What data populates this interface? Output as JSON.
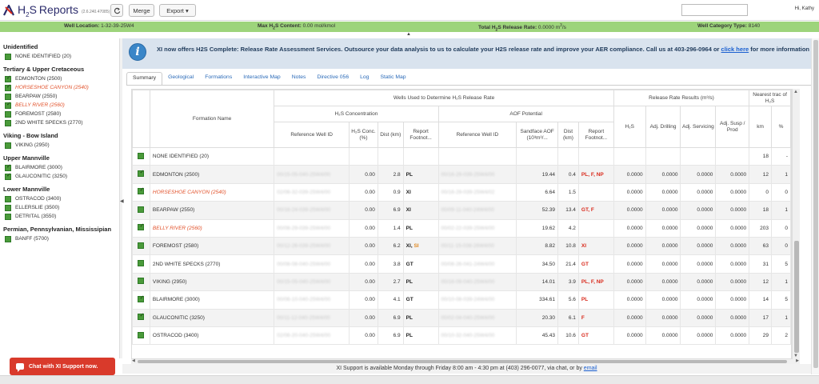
{
  "app": {
    "logo_text_h": "H",
    "logo_text_sub": "2",
    "logo_text_s": "S",
    "logo_text_reports": "Reports",
    "version": "(2.6.240.47085)",
    "refresh_icon": "refresh-icon",
    "merge_label": "Merge",
    "export_label": "Export",
    "export_caret": "▾",
    "user_greeting": "Hi, Kathy"
  },
  "infobar": {
    "well_location_label": "Well Location:",
    "well_location_value": "1-32-39-25W4",
    "max_h2s_label": "Max H",
    "max_h2s_sub": "2",
    "max_h2s_label_rest": "S Content:",
    "max_h2s_value": "0.00 mol/kmol",
    "total_release_label": "Total H",
    "total_release_sub": "2",
    "total_release_label_rest": "S Release Rate:",
    "total_release_value": "0.0000 m",
    "total_release_sup": "3",
    "total_release_unit_rest": "/s",
    "well_category_label": "Well Category Type:",
    "well_category_value": "8140"
  },
  "sidebar": {
    "groups": [
      {
        "title": "Unidentified",
        "items": [
          {
            "label": "NONE IDENTIFIED (20)",
            "style": "",
            "mark": false
          }
        ]
      },
      {
        "title": "Tertiary & Upper Cretaceous",
        "items": [
          {
            "label": "EDMONTON (2500)",
            "style": "",
            "mark": true
          },
          {
            "label": "HORSESHOE CANYON (2540)",
            "style": "red",
            "mark": true
          },
          {
            "label": "BEARPAW (2550)",
            "style": "",
            "mark": false
          },
          {
            "label": "BELLY RIVER (2560)",
            "style": "red",
            "mark": true
          },
          {
            "label": "FOREMOST (2580)",
            "style": "",
            "mark": false
          },
          {
            "label": "2ND WHITE SPECKS (2770)",
            "style": "",
            "mark": false
          }
        ]
      },
      {
        "title": "Viking - Bow Island",
        "items": [
          {
            "label": "VIKING (2950)",
            "style": "",
            "mark": false
          }
        ]
      },
      {
        "title": "Upper Mannville",
        "items": [
          {
            "label": "BLAIRMORE (3000)",
            "style": "",
            "mark": true
          },
          {
            "label": "GLAUCONITIC (3250)",
            "style": "",
            "mark": true
          }
        ]
      },
      {
        "title": "Lower Mannville",
        "items": [
          {
            "label": "OSTRACOD (3400)",
            "style": "",
            "mark": false
          },
          {
            "label": "ELLERSLIE (3500)",
            "style": "",
            "mark": false
          },
          {
            "label": "DETRITAL (3550)",
            "style": "",
            "mark": false
          }
        ]
      },
      {
        "title": "Permian, Pennsylvanian, Mississipian",
        "items": [
          {
            "label": "BANFF (5700)",
            "style": "",
            "mark": false
          }
        ]
      }
    ]
  },
  "chat": {
    "label": "Chat with XI Support now."
  },
  "banner": {
    "icon": "info-icon",
    "text": "XI now offers H2S Complete: Release Rate Assessment Services. Outsource your data analysis to us to calculate your H2S release rate and improve your AER compliance. Call us at 403-296-0964 or ",
    "link_text": "click here",
    "text_after": " for more information"
  },
  "tabs": [
    "Summary",
    "Geological",
    "Formations",
    "Interactive Map",
    "Notes",
    "Directive 056",
    "Log",
    "Static Map"
  ],
  "table": {
    "headers": {
      "formation_name": "Formation Name",
      "wells_used": "Wells Used to Determine H₂S Release Rate",
      "h2s_concentration": "H₂S Concentration",
      "aof_potential": "AOF Potential",
      "release_rate_results": "Release Rate Results (m³/s)",
      "nearest": "Nearest trac of H₂S",
      "reference_well_id": "Reference Well ID",
      "h2s_conc": "H₂S Conc. (%)",
      "dist_km": "Dist (km)",
      "report_footnote": "Report Footnot...",
      "sandface_aof": "Sandface AOF (10³m³/...",
      "h2s": "H₂S",
      "adj_drilling": "Adj. Drilling",
      "adj_servicing": "Adj. Servicing",
      "adj_susp_prod": "Adj. Susp / Prod",
      "km": "km",
      "pct": "%"
    },
    "rows": [
      {
        "name": "NONE IDENTIFIED (20)",
        "style": "",
        "mark": false,
        "ref1": "",
        "conc": "",
        "dist1": "",
        "fn1": [],
        "ref2": "",
        "aof": "",
        "dist2": "",
        "fn2": [],
        "h2s": "",
        "drill": "",
        "serv": "",
        "susp": "",
        "km": "18",
        "pct": "-"
      },
      {
        "name": "EDMONTON (2500)",
        "style": "",
        "mark": true,
        "ref1": "00/15-05-040-25W4/00",
        "conc": "0.00",
        "dist1": "2.8",
        "fn1": [
          {
            "t": "PL",
            "c": ""
          }
        ],
        "ref2": "00/16-29-039-25W4/00",
        "aof": "19.44",
        "dist2": "0.4",
        "fn2": [
          {
            "t": "PL, F, NP",
            "c": "r"
          }
        ],
        "h2s": "0.0000",
        "drill": "0.0000",
        "serv": "0.0000",
        "susp": "0.0000",
        "km": "12",
        "pct": "1"
      },
      {
        "name": "HORSESHOE CANYON (2540)",
        "style": "red",
        "mark": true,
        "ref1": "02/06-32-039-25W4/00",
        "conc": "0.00",
        "dist1": "0.9",
        "fn1": [
          {
            "t": "XI",
            "c": ""
          }
        ],
        "ref2": "00/16-29-039-25W4/02",
        "aof": "6.64",
        "dist2": "1.5",
        "fn2": [],
        "h2s": "0.0000",
        "drill": "0.0000",
        "serv": "0.0000",
        "susp": "0.0000",
        "km": "0",
        "pct": "0"
      },
      {
        "name": "BEARPAW (2550)",
        "style": "",
        "mark": false,
        "ref1": "00/16-24-039-25W4/00",
        "conc": "0.00",
        "dist1": "6.9",
        "fn1": [
          {
            "t": "XI",
            "c": ""
          }
        ],
        "ref2": "00/09-11-040-24W4/00",
        "aof": "52.39",
        "dist2": "13.4",
        "fn2": [
          {
            "t": "GT, F",
            "c": "r"
          }
        ],
        "h2s": "0.0000",
        "drill": "0.0000",
        "serv": "0.0000",
        "susp": "0.0000",
        "km": "18",
        "pct": "1"
      },
      {
        "name": "BELLY RIVER (2560)",
        "style": "red",
        "mark": true,
        "ref1": "00/08-29-039-25W4/00",
        "conc": "0.00",
        "dist1": "1.4",
        "fn1": [
          {
            "t": "PL",
            "c": ""
          }
        ],
        "ref2": "00/02-22-039-25W4/00",
        "aof": "19.62",
        "dist2": "4.2",
        "fn2": [],
        "h2s": "0.0000",
        "drill": "0.0000",
        "serv": "0.0000",
        "susp": "0.0000",
        "km": "203",
        "pct": "0"
      },
      {
        "name": "FOREMOST (2580)",
        "style": "",
        "mark": false,
        "ref1": "00/12-26-039-25W4/00",
        "conc": "0.00",
        "dist1": "6.2",
        "fn1": [
          {
            "t": "XI, ",
            "c": ""
          },
          {
            "t": "SI",
            "c": "o"
          }
        ],
        "ref2": "00/11-15-038-26W4/00",
        "aof": "8.82",
        "dist2": "10.8",
        "fn2": [
          {
            "t": "XI",
            "c": "r"
          }
        ],
        "h2s": "0.0000",
        "drill": "0.0000",
        "serv": "0.0000",
        "susp": "0.0000",
        "km": "63",
        "pct": "0"
      },
      {
        "name": "2ND WHITE SPECKS (2770)",
        "style": "",
        "mark": false,
        "ref1": "00/08-08-040-25W4/00",
        "conc": "0.00",
        "dist1": "3.8",
        "fn1": [
          {
            "t": "GT",
            "c": ""
          }
        ],
        "ref2": "00/08-26-041-24W4/00",
        "aof": "34.50",
        "dist2": "21.4",
        "fn2": [
          {
            "t": "GT",
            "c": "r"
          }
        ],
        "h2s": "0.0000",
        "drill": "0.0000",
        "serv": "0.0000",
        "susp": "0.0000",
        "km": "31",
        "pct": "5"
      },
      {
        "name": "VIKING (2950)",
        "style": "",
        "mark": false,
        "ref1": "00/15-05-040-25W4/00",
        "conc": "0.00",
        "dist1": "2.7",
        "fn1": [
          {
            "t": "PL",
            "c": ""
          }
        ],
        "ref2": "00/16-09-040-25W4/00",
        "aof": "14.01",
        "dist2": "3.9",
        "fn2": [
          {
            "t": "PL, F, NP",
            "c": "r"
          }
        ],
        "h2s": "0.0000",
        "drill": "0.0000",
        "serv": "0.0000",
        "susp": "0.0000",
        "km": "12",
        "pct": "1"
      },
      {
        "name": "BLAIRMORE (3000)",
        "style": "",
        "mark": true,
        "ref1": "00/06-10-040-25W4/00",
        "conc": "0.00",
        "dist1": "4.1",
        "fn1": [
          {
            "t": "GT",
            "c": ""
          }
        ],
        "ref2": "00/10-08-039-24W4/00",
        "aof": "334.61",
        "dist2": "5.6",
        "fn2": [
          {
            "t": "PL",
            "c": "r"
          }
        ],
        "h2s": "0.0000",
        "drill": "0.0000",
        "serv": "0.0000",
        "susp": "0.0000",
        "km": "14",
        "pct": "5"
      },
      {
        "name": "GLAUCONITIC (3250)",
        "style": "",
        "mark": true,
        "ref1": "00/11-12-040-25W4/00",
        "conc": "0.00",
        "dist1": "6.9",
        "fn1": [
          {
            "t": "PL",
            "c": ""
          }
        ],
        "ref2": "00/02-04-040-25W4/00",
        "aof": "20.30",
        "dist2": "6.1",
        "fn2": [
          {
            "t": "F",
            "c": "r"
          }
        ],
        "h2s": "0.0000",
        "drill": "0.0000",
        "serv": "0.0000",
        "susp": "0.0000",
        "km": "17",
        "pct": "1"
      },
      {
        "name": "OSTRACOD (3400)",
        "style": "",
        "mark": false,
        "ref1": "02/06-20-040-25W4/00",
        "conc": "0.00",
        "dist1": "6.9",
        "fn1": [
          {
            "t": "PL",
            "c": ""
          }
        ],
        "ref2": "00/10-32-040-25W4/00",
        "aof": "45.43",
        "dist2": "10.6",
        "fn2": [
          {
            "t": "GT",
            "c": "r"
          }
        ],
        "h2s": "0.0000",
        "drill": "0.0000",
        "serv": "0.0000",
        "susp": "0.0000",
        "km": "29",
        "pct": "2"
      }
    ]
  },
  "footer": {
    "text": "XI Support is available Monday through Friday 8:00 am - 4:30 pm at (403) 296-0077, via chat, or by ",
    "link": "email"
  },
  "colors": {
    "green_bar": "#9dd47b",
    "formation_green": "#4a9a3a",
    "red_label": "#e2522b",
    "chat_red": "#d93a2b",
    "banner_bg": "#d9e3ee"
  }
}
